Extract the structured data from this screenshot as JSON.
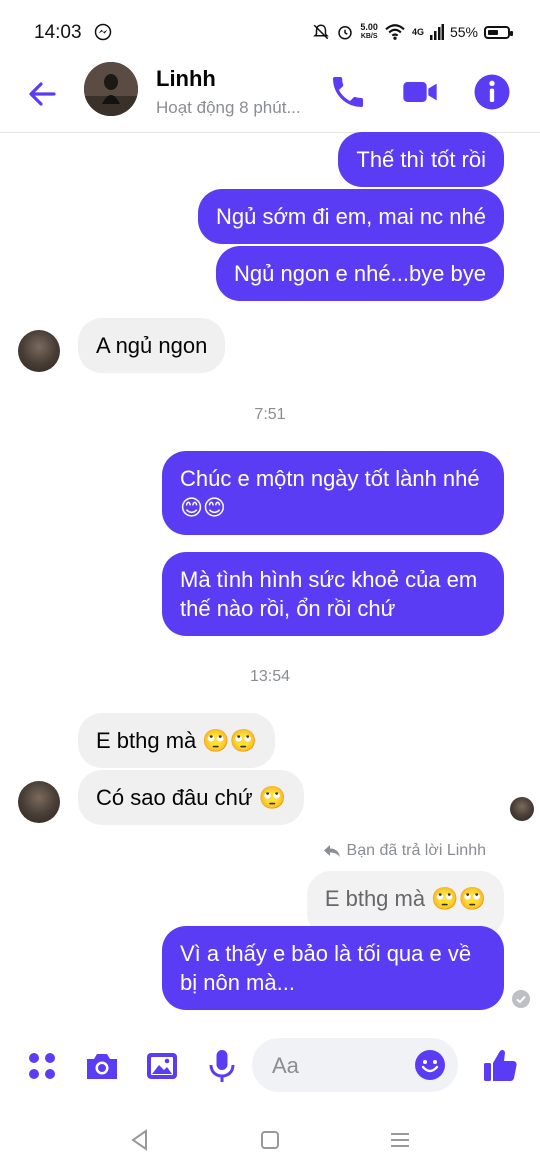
{
  "status_bar": {
    "time": "14:03",
    "speed_value": "5.00",
    "speed_unit": "KB/S",
    "network": "4G",
    "battery": "55%",
    "battery_level": 0.55
  },
  "header": {
    "name": "Linhh",
    "status": "Hoạt động 8 phút..."
  },
  "messages": {
    "m1": "Thế thì tốt rồi",
    "m2": "Ngủ sớm đi em, mai nc nhé",
    "m3": "Ngủ ngon e nhé...bye bye",
    "m4": "A ngủ ngon",
    "ts1": "7:51",
    "m5": "Chúc e mộtn ngày tốt lành nhé 😊😊",
    "m6": "Mà tình hình sức khoẻ của em thế nào rồi, ổn rồi chứ",
    "ts2": "13:54",
    "m7": "E bthg mà 🙄🙄",
    "m8": "Có sao đâu chứ 🙄",
    "reply_note": "Bạn đã trả lời Linhh",
    "quote": "E bthg mà 🙄🙄",
    "m9": "Vì a thấy e bảo là tối qua e về bị nôn mà..."
  },
  "composer": {
    "placeholder": "Aa"
  },
  "colors": {
    "accent": "#5b3cf5",
    "incoming_bubble": "#f0f0f0"
  }
}
